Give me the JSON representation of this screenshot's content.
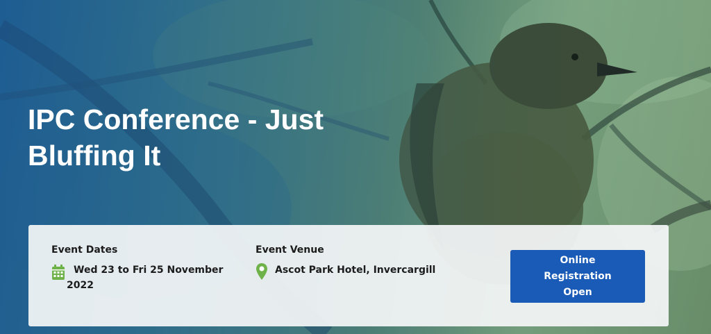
{
  "hero": {
    "title": "IPC Conference - Just Bluffing It",
    "background_image": "bird perched on branch"
  },
  "event": {
    "dates_label": "Event Dates",
    "dates_value": "Wed 23 to Fri 25 November 2022",
    "venue_label": "Event Venue",
    "venue_value": "Ascot Park Hotel, Invercargill",
    "register_label": "Online Registration Open"
  },
  "icons": {
    "calendar": "calendar-icon",
    "location": "map-pin-icon"
  },
  "colors": {
    "accent_button": "#1a5bb7",
    "icon_green": "#6fb24a",
    "title_text": "#ffffff"
  }
}
